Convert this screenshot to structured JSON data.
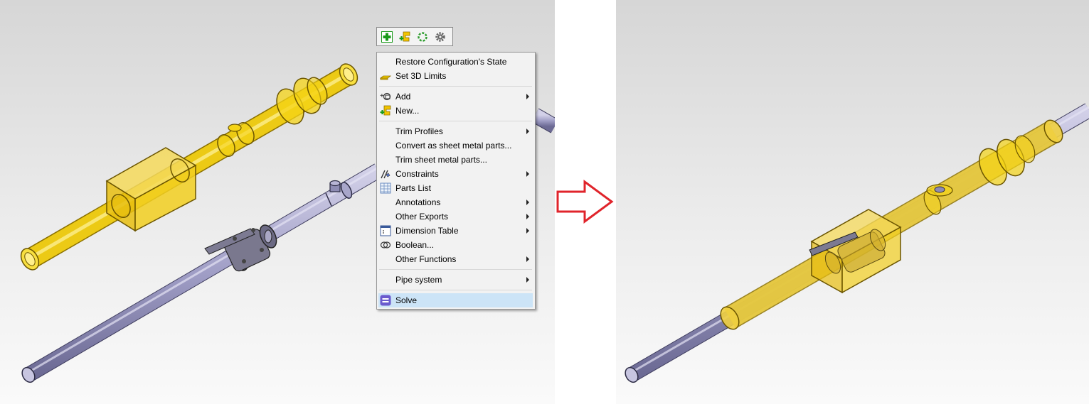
{
  "toolbar": {
    "items": [
      {
        "name": "add-icon",
        "color": "#1a9a1a"
      },
      {
        "name": "new-part-icon",
        "color": "#e8b400"
      },
      {
        "name": "refresh-icon",
        "color": "#2e9d2e"
      },
      {
        "name": "settings-gear-icon",
        "color": "#666666"
      }
    ]
  },
  "context_menu": {
    "items": [
      {
        "label": "Restore Configuration's State"
      },
      {
        "label": "Set 3D Limits",
        "icon": "3d-limits-icon"
      },
      {
        "label": "Add",
        "icon": "add-component-icon",
        "submenu": true
      },
      {
        "label": "New...",
        "icon": "new-part-icon"
      },
      {
        "label": "Trim Profiles",
        "submenu": true
      },
      {
        "label": "Convert as sheet metal parts..."
      },
      {
        "label": "Trim sheet metal parts..."
      },
      {
        "label": "Constraints",
        "icon": "constraints-icon",
        "submenu": true
      },
      {
        "label": "Parts List",
        "icon": "parts-list-icon"
      },
      {
        "label": "Annotations",
        "submenu": true
      },
      {
        "label": "Other Exports",
        "submenu": true
      },
      {
        "label": "Dimension Table",
        "icon": "dimension-table-icon",
        "submenu": true
      },
      {
        "label": "Boolean...",
        "icon": "boolean-icon"
      },
      {
        "label": "Other Functions",
        "submenu": true
      },
      {
        "label": "Pipe system",
        "submenu": true
      },
      {
        "label": "Solve",
        "icon": "solve-icon",
        "highlighted": true
      }
    ]
  },
  "colors": {
    "pipe": "#9a98c0",
    "transparent_part": "#f5d000",
    "arrow": "#e0242b",
    "menu_highlight": "#cce4f7"
  }
}
